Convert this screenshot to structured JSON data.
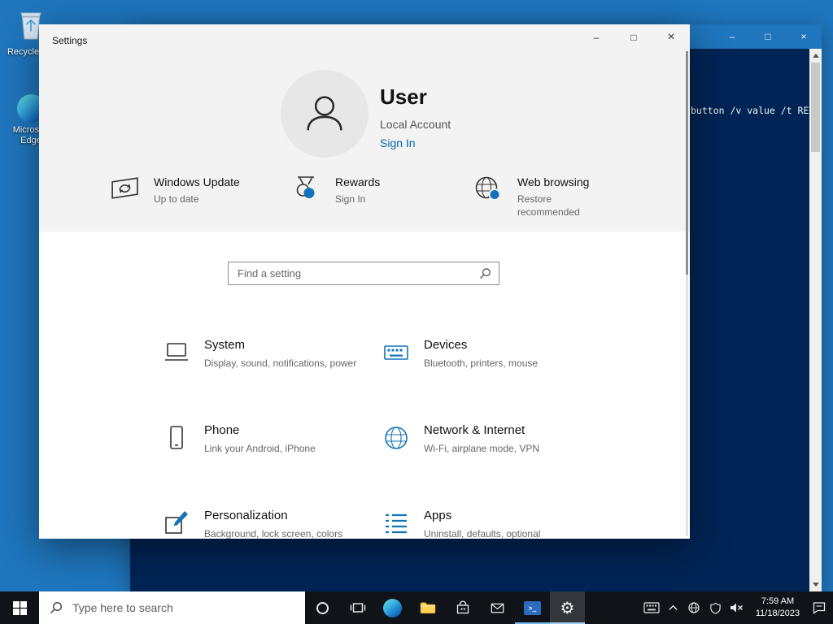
{
  "colors": {
    "desktop": "#1f76bd",
    "accent": "#0067b8",
    "icon_blue": "#1273b8",
    "terminal_bg": "#012456",
    "taskbar_bg": "#101318"
  },
  "glyphs": {
    "gear": "⚙"
  },
  "window_controls": {
    "minimize": "–",
    "maximize": "□",
    "close": "×"
  },
  "desktop": {
    "recycle_bin_label": "Recycle Bin",
    "edge_label": "Microsoft Edge"
  },
  "terminal": {
    "text_fragment": "button /v value /t RE"
  },
  "settings": {
    "title": "Settings",
    "user": {
      "name": "User",
      "account": "Local Account",
      "sign_in": "Sign In"
    },
    "quick": [
      {
        "title": "Windows Update",
        "status": "Up to date"
      },
      {
        "title": "Rewards",
        "status": "Sign In"
      },
      {
        "title": "Web browsing",
        "status": "Restore recommended"
      }
    ],
    "search_placeholder": "Find a setting",
    "categories": [
      {
        "title": "System",
        "desc": "Display, sound, notifications, power"
      },
      {
        "title": "Devices",
        "desc": "Bluetooth, printers, mouse"
      },
      {
        "title": "Phone",
        "desc": "Link your Android, iPhone"
      },
      {
        "title": "Network & Internet",
        "desc": "Wi-Fi, airplane mode, VPN"
      },
      {
        "title": "Personalization",
        "desc": "Background, lock screen, colors"
      },
      {
        "title": "Apps",
        "desc": "Uninstall, defaults, optional"
      }
    ]
  },
  "taskbar": {
    "search_placeholder": "Type here to search",
    "time": "7:59 AM",
    "date": "11/18/2023"
  }
}
